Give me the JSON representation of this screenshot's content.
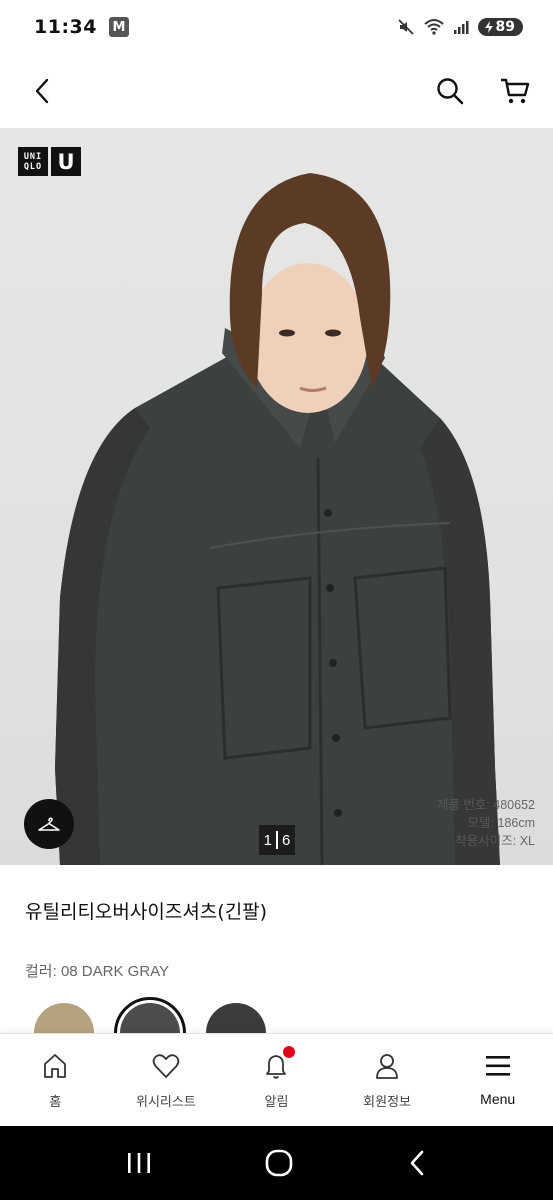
{
  "status_bar": {
    "time": "11:34",
    "notification_badge": "M",
    "battery": "89",
    "icons": [
      "mute-icon",
      "wifi-icon",
      "signal-icon",
      "battery-icon"
    ]
  },
  "header": {
    "back_icon": "chevron-left-icon",
    "search_icon": "search-icon",
    "cart_icon": "cart-icon"
  },
  "hero": {
    "logo_top": "UNI",
    "logo_bottom": "QLO",
    "logo_u": "U",
    "pager_current": "1",
    "pager_total": "6",
    "model_info": [
      "제품 번호: 480652",
      "모델: 186cm",
      "착용사이즈: XL"
    ],
    "hanger_icon": "hanger-icon"
  },
  "product": {
    "title": "유틸리티오버사이즈셔츠(긴팔)",
    "color_label": "컬러:",
    "color_value": "08 DARK GRAY",
    "swatches": [
      {
        "color": "#b5a37f",
        "selected": false
      },
      {
        "color": "#4a4d4b",
        "selected": true
      },
      {
        "color": "#3b3c3d",
        "selected": false
      }
    ]
  },
  "bottom_nav": {
    "items": [
      {
        "label": "홈",
        "icon": "home-icon"
      },
      {
        "label": "위시리스트",
        "icon": "heart-icon"
      },
      {
        "label": "알림",
        "icon": "bell-icon"
      },
      {
        "label": "회원정보",
        "icon": "user-icon"
      },
      {
        "label": "Menu",
        "icon": "menu-icon"
      }
    ]
  },
  "colors": {
    "accent_red": "#e3001b",
    "text_primary": "#111111",
    "text_secondary": "#666666"
  }
}
